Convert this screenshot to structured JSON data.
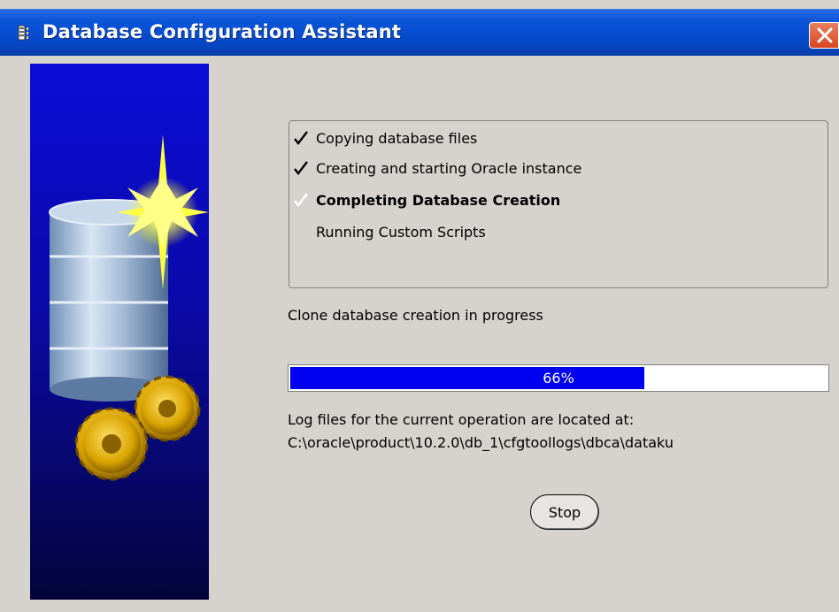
{
  "window": {
    "title": "Database Configuration Assistant",
    "close_icon": "close-icon",
    "title_icon": "oracle-dbca-icon"
  },
  "steps": [
    {
      "label": "Copying database files",
      "state": "done"
    },
    {
      "label": "Creating and starting Oracle instance",
      "state": "done"
    },
    {
      "label": "Completing Database Creation",
      "state": "in-progress"
    },
    {
      "label": "Running Custom Scripts",
      "state": "pending"
    }
  ],
  "status": {
    "text": "Clone database creation in progress"
  },
  "progress": {
    "value": 66,
    "label": "66%"
  },
  "log": {
    "line1": "Log files for the current operation are located at:",
    "line2": "C:\\oracle\\product\\10.2.0\\db_1\\cfgtoollogs\\dbca\\dataku"
  },
  "buttons": {
    "stop_label": "Stop"
  },
  "colors": {
    "titlebar": "#0a54d8",
    "progress_fill": "#0000f0",
    "banner": "#0a0aa8",
    "close_button": "#d8451f"
  }
}
